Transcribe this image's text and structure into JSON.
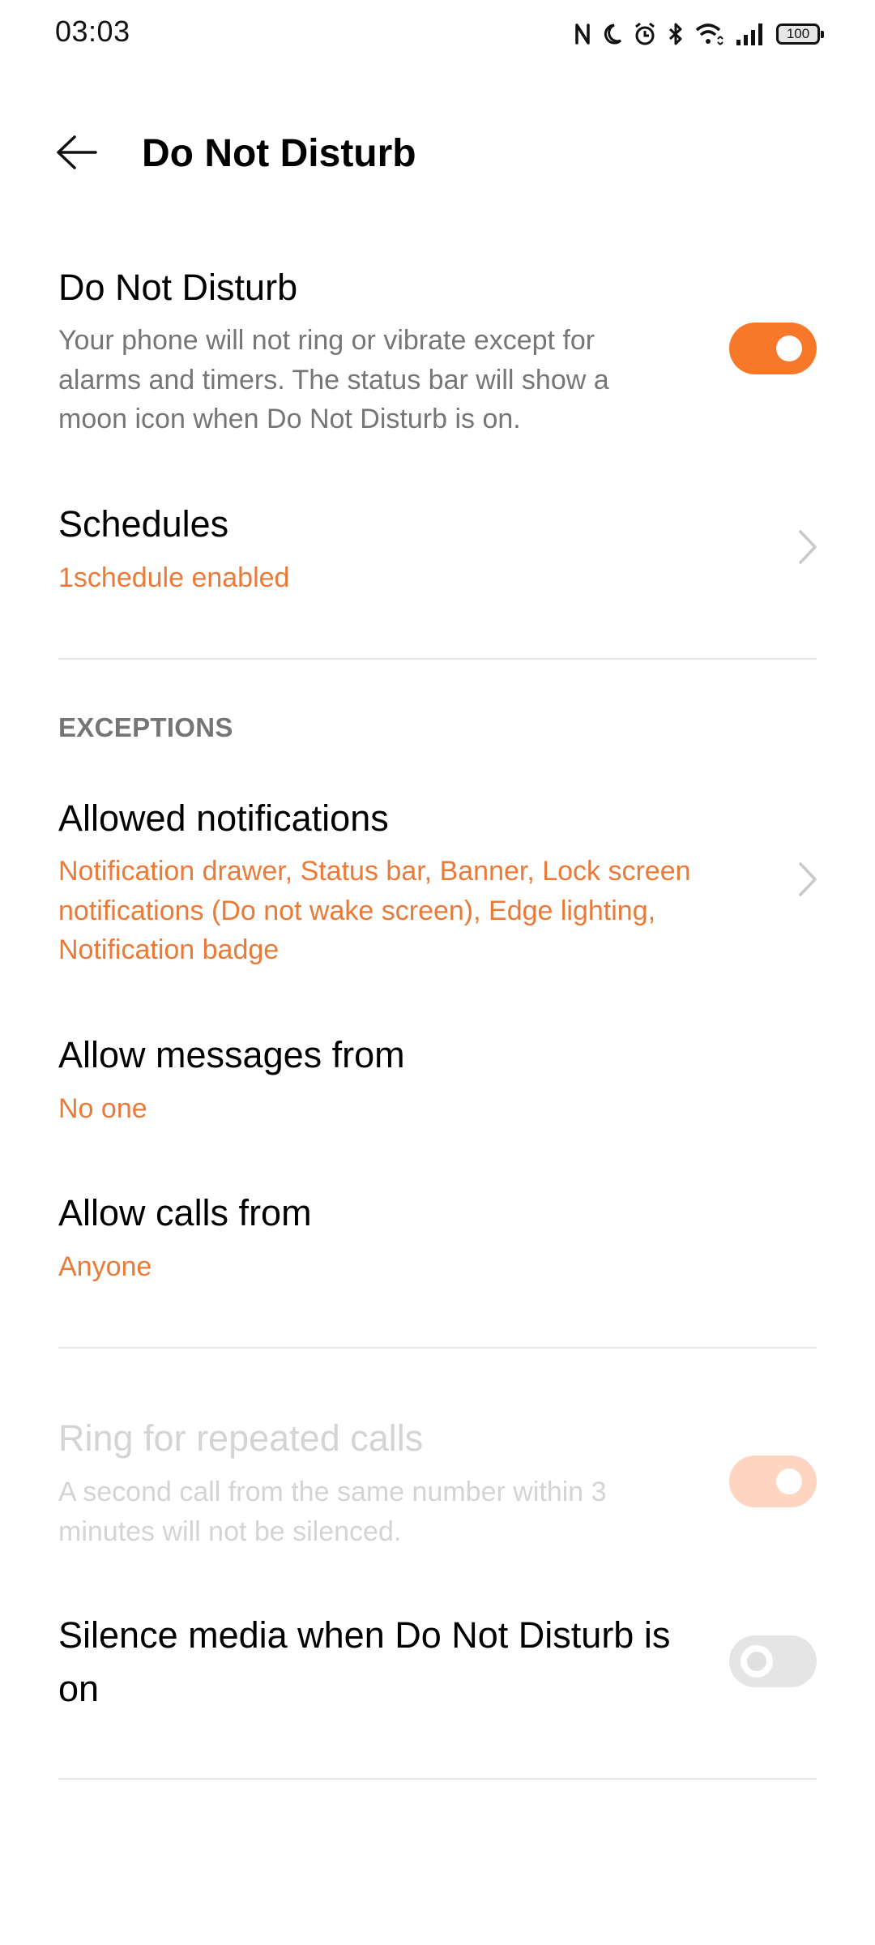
{
  "status_bar": {
    "time": "03:03",
    "icons": [
      "nfc-icon",
      "moon-icon",
      "alarm-icon",
      "bluetooth-icon",
      "wifi-icon",
      "signal-icon",
      "battery-icon"
    ],
    "battery_level": "100"
  },
  "header": {
    "back_icon": "arrow-left-icon",
    "title": "Do Not Disturb"
  },
  "colors": {
    "accent": "#F8782A",
    "accent_text": "#EA7A38",
    "accent_disabled": "#FDD5C0",
    "secondary_text": "#767676",
    "divider": "#E6E6E6"
  },
  "dnd": {
    "title": "Do Not Disturb",
    "description": "Your phone will not ring or vibrate except for alarms and timers. The status bar will show a moon icon when Do Not Disturb is on.",
    "enabled": true
  },
  "schedules": {
    "title": "Schedules",
    "subtitle": "1schedule enabled"
  },
  "exceptions": {
    "section_label": "EXCEPTIONS",
    "allowed_notifications": {
      "title": "Allowed notifications",
      "subtitle": "Notification drawer, Status bar, Banner, Lock screen notifications (Do not wake screen), Edge lighting, Notification badge"
    },
    "allow_messages": {
      "title": "Allow messages from",
      "value": "No one"
    },
    "allow_calls": {
      "title": "Allow calls from",
      "value": "Anyone"
    }
  },
  "repeated_calls": {
    "title": "Ring for repeated calls",
    "description": "A second call from the same number within 3 minutes will not be silenced.",
    "enabled": true,
    "disabled": true
  },
  "silence_media": {
    "title": "Silence media when Do Not Disturb is on",
    "enabled": false
  }
}
